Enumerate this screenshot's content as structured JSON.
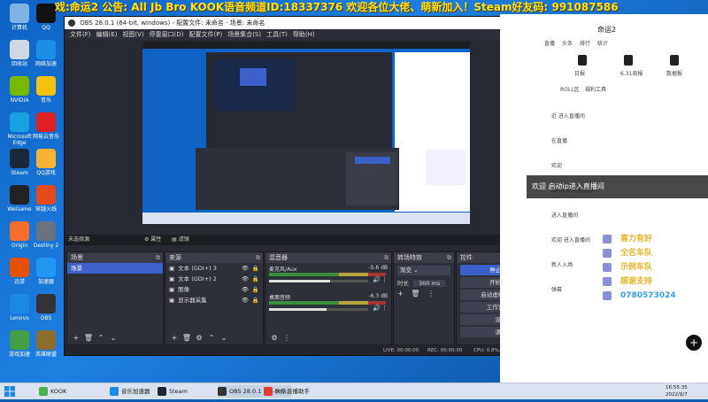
{
  "banner": {
    "text": "戏:命运2  公告: All Jb Bro  KOOK语音频道ID:18337376 欢迎各位大佬、萌新加入！Steam好友码: 991087586"
  },
  "desktop_icons": [
    {
      "label": "计算机",
      "color": "#7fb3e6"
    },
    {
      "label": "QQ",
      "color": "#111"
    },
    {
      "label": "回收站",
      "color": "#cfd8e3"
    },
    {
      "label": "网络加速",
      "color": "#1a8fe3"
    },
    {
      "label": "NVIDIA",
      "color": "#76b900"
    },
    {
      "label": "音乐",
      "color": "#f4c20d"
    },
    {
      "label": "Microsoft Edge",
      "color": "#1ba1e2"
    },
    {
      "label": "网易云音乐",
      "color": "#e02020"
    },
    {
      "label": "Steam",
      "color": "#1b2838"
    },
    {
      "label": "QQ游戏",
      "color": "#f9b233"
    },
    {
      "label": "WeGame",
      "color": "#222"
    },
    {
      "label": "穿越火线",
      "color": "#e64a19"
    },
    {
      "label": "Origin",
      "color": "#f56c2d"
    },
    {
      "label": "Destiny 2",
      "color": "#6a7480"
    },
    {
      "label": "迅游",
      "color": "#e65100"
    },
    {
      "label": "加速器",
      "color": "#2196f3"
    },
    {
      "label": "Lenovo",
      "color": "#1e88e5"
    },
    {
      "label": "OBS",
      "color": "#333"
    },
    {
      "label": "游戏加速",
      "color": "#43a047"
    },
    {
      "label": "英雄联盟",
      "color": "#8d6e2f"
    }
  ],
  "obs": {
    "title": "OBS 28.0.1 (64-bit, windows) - 配置文件: 未命名 - 场景: 未命名",
    "menu": [
      "文件(F)",
      "编辑(E)",
      "视图(V)",
      "停靠窗口(D)",
      "配置文件(P)",
      "场景集合(S)",
      "工具(T)",
      "帮助(H)"
    ],
    "source_bar": {
      "none": "未选择源",
      "props": "属性",
      "filters": "滤镜"
    },
    "docks": {
      "scenes": {
        "title": "场景",
        "items": [
          "场景"
        ]
      },
      "sources": {
        "title": "来源",
        "items": [
          "文本 (GDI+) 3",
          "文本 (GDI+) 2",
          "图像",
          "显示器采集"
        ]
      },
      "mixer": {
        "title": "混音器",
        "channels": [
          {
            "name": "麦克风/Aux",
            "db": "-5.6 dB",
            "level": 0.62
          },
          {
            "name": "桌面音频",
            "db": "-6.3 dB",
            "level": 0.58
          }
        ]
      },
      "transitions": {
        "title": "转场特效",
        "type": "渐变",
        "duration_label": "时长",
        "duration": "300 ms"
      },
      "controls": {
        "title": "控件",
        "buttons": [
          "停止推流",
          "开始录制",
          "启动虚拟摄像机",
          "工作室模式",
          "设置",
          "退出"
        ]
      }
    },
    "status": {
      "live": "LIVE: 00:00:00",
      "rec": "REC: 00:00:00",
      "cpu": "CPU: 0.8%, 60.00 fps"
    }
  },
  "right_panel": {
    "header": "命运2",
    "tabs": [
      "直播",
      "头条",
      "排行",
      "统计"
    ],
    "badges": [
      "日报",
      "6.31周报",
      "数据报"
    ],
    "subtabs": [
      "ROLL区",
      "福利工具"
    ],
    "messages": [
      "近 进入直播间",
      "在直播",
      "欢迎",
      "启动ip进入直播间",
      "进入直播间",
      "欢迎 进入直播间",
      "新人入场",
      "弹幕"
    ],
    "welcome": "欢迎    启动ip进入直播间",
    "overlay_lines": [
      "喜力有好",
      "全名车队",
      "示例车队",
      "感谢支持",
      "0780573024"
    ]
  },
  "taskbar": {
    "items": [
      "KOOK",
      "音乐加速器",
      "Steam",
      "OBS 28.0.1 (64-bit...",
      "头条直播助手"
    ],
    "time": "16:55:35",
    "date": "2022/9/7"
  }
}
